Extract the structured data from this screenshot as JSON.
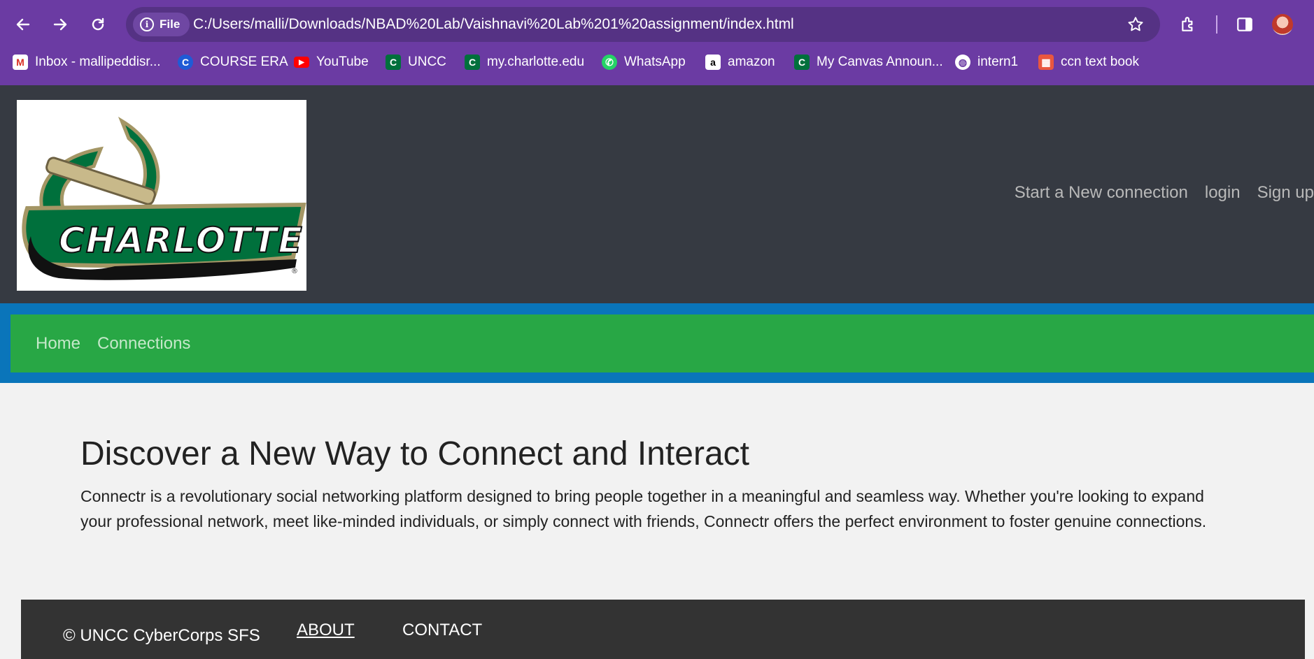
{
  "browser": {
    "site_chip_label": "File",
    "url": "C:/Users/malli/Downloads/NBAD%20Lab/Vaishnavi%20Lab%201%20assignment/index.html"
  },
  "bookmarks": [
    {
      "label": "Inbox - mallipeddisr...",
      "icon": "gmail-icon"
    },
    {
      "label": "COURSE ERA",
      "icon": "coursera-icon"
    },
    {
      "label": "YouTube",
      "icon": "youtube-icon"
    },
    {
      "label": "UNCC",
      "icon": "uncc-icon"
    },
    {
      "label": "my.charlotte.edu",
      "icon": "uncc-icon"
    },
    {
      "label": "WhatsApp",
      "icon": "whatsapp-icon"
    },
    {
      "label": "amazon",
      "icon": "amazon-icon"
    },
    {
      "label": "My Canvas Announ...",
      "icon": "uncc-icon"
    },
    {
      "label": "intern1",
      "icon": "globe-icon"
    },
    {
      "label": "ccn text book",
      "icon": "book-icon"
    }
  ],
  "logo": {
    "text": "CHARLOTTE"
  },
  "header_nav": {
    "start_connection": "Start a New connection",
    "login": "login",
    "signup": "Sign up"
  },
  "main_nav": {
    "home": "Home",
    "connections": "Connections"
  },
  "main": {
    "heading": "Discover a New Way to Connect and Interact",
    "paragraph": "Connectr is a revolutionary social networking platform designed to bring people together in a meaningful and seamless way. Whether you're looking to expand your professional network, meet like-minded individuals, or simply connect with friends, Connectr offers the perfect environment to foster genuine connections."
  },
  "footer": {
    "copyright": "© UNCC CyberCorps SFS",
    "about": "ABOUT",
    "contact": "CONTACT"
  },
  "colors": {
    "browser_frame": "#6b3ba3",
    "header_bg": "#363a42",
    "blue_band": "#0a75ba",
    "green_nav": "#28a745",
    "footer_bg": "#333333",
    "charlotte_green": "#00703c",
    "charlotte_gold": "#a49665"
  }
}
